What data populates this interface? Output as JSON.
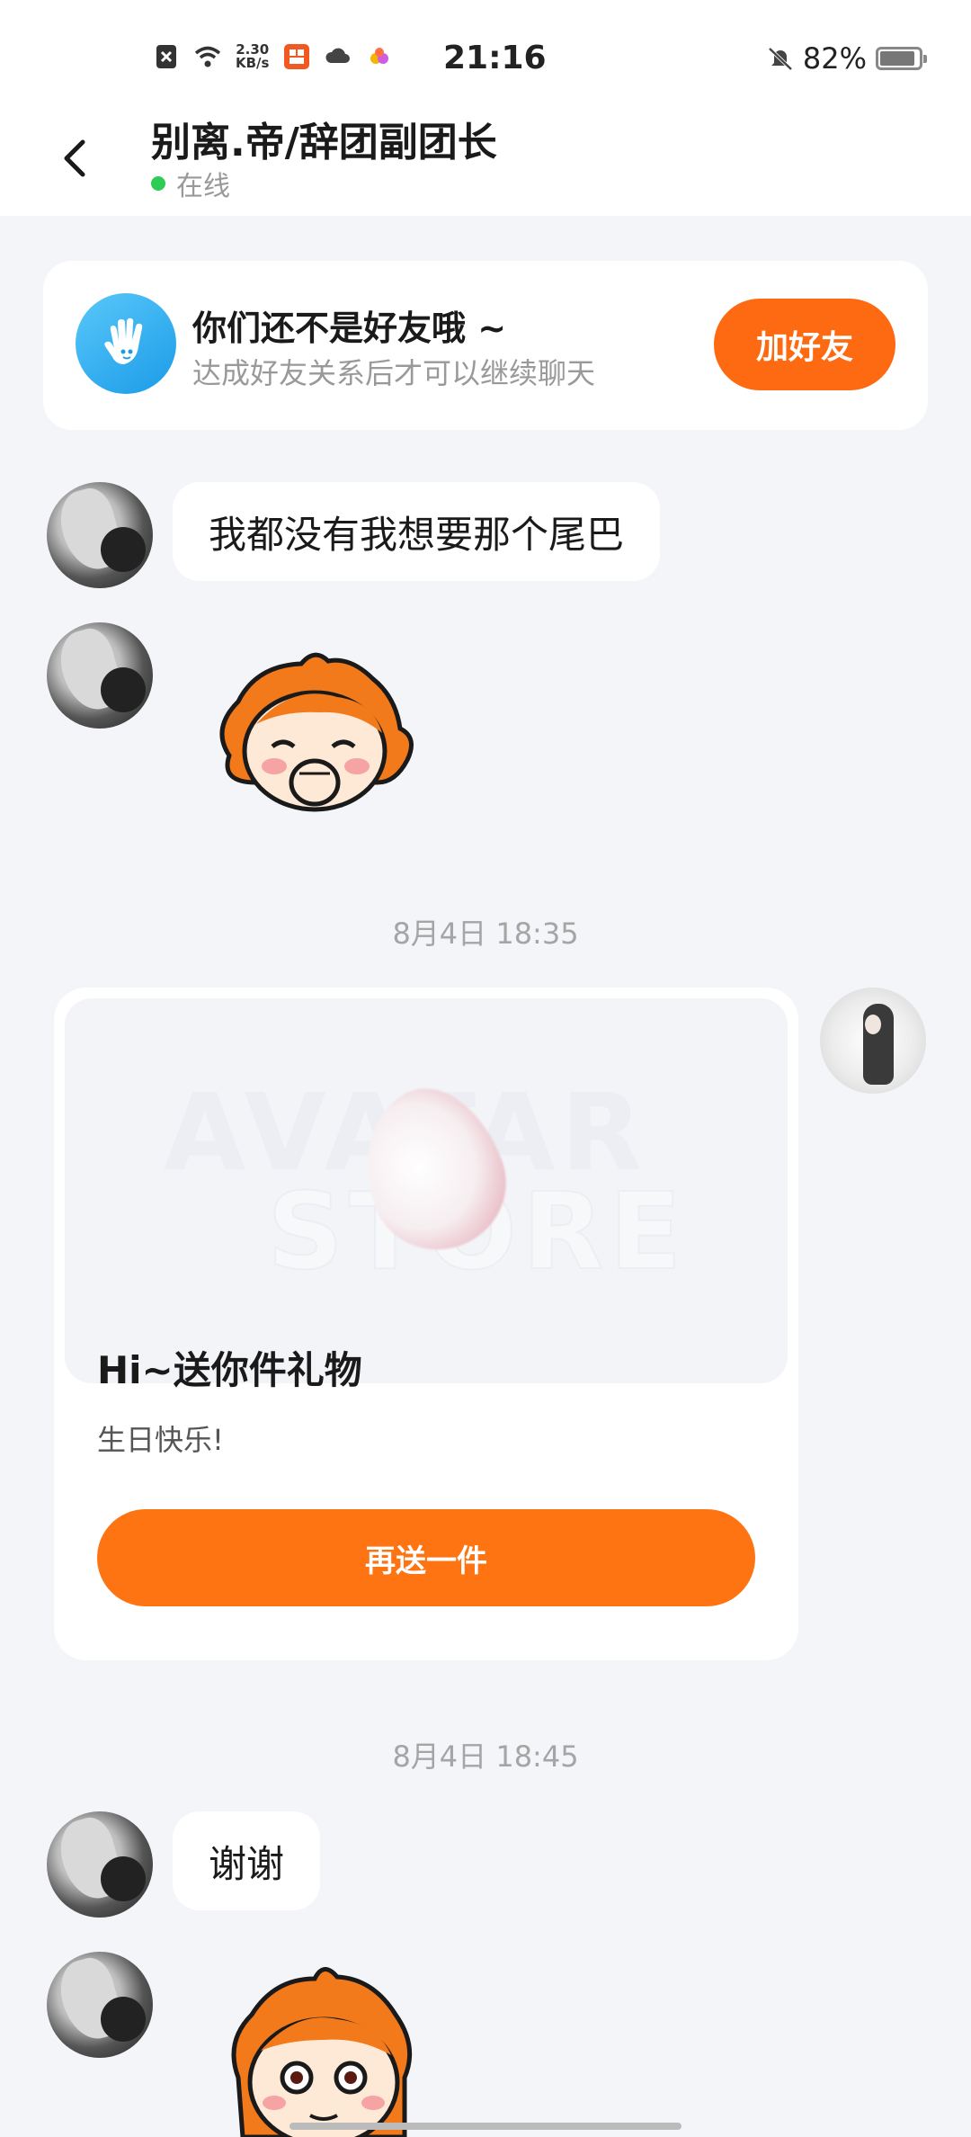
{
  "status_bar": {
    "net_speed_value": "2.30",
    "net_speed_unit": "KB/s",
    "time": "21:16",
    "battery_percent": "82%",
    "battery_level": 0.82
  },
  "header": {
    "title": "别离.帝/辞团副团长",
    "status": "在线"
  },
  "friend_notice": {
    "title": "你们还不是好友哦 ~",
    "subtitle": "达成好友关系后才可以继续聊天",
    "button": "加好友"
  },
  "messages": [
    {
      "text": "我都没有我想要那个尾巴"
    },
    {
      "sticker": "orange-character-laughing-sticker"
    }
  ],
  "timestamps": [
    "8月4日 18:35",
    "8月4日 18:45"
  ],
  "gift_card": {
    "watermark_line1": "AVATAR",
    "watermark_line2": "STORE",
    "title": "Hi~送你件礼物",
    "message": "生日快乐!",
    "button": "再送一件"
  },
  "reply": {
    "text": "谢谢"
  },
  "colors": {
    "accent": "#fe6a12",
    "online": "#2dcc55",
    "background": "#f4f5f9"
  }
}
